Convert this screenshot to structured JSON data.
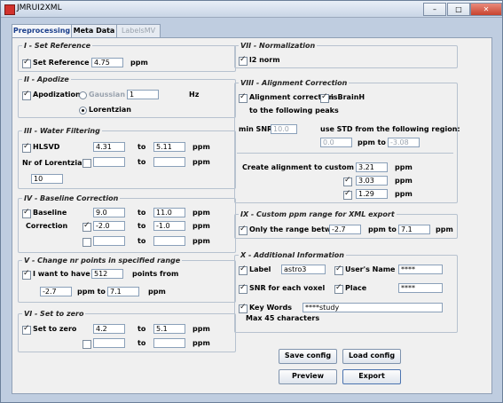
{
  "window": {
    "title": "JMRUI2XML",
    "btn_min": "–",
    "btn_max": "□",
    "btn_close": "✕"
  },
  "tabs": [
    {
      "label": "Preprocessing"
    },
    {
      "label": "Meta Data"
    },
    {
      "label": "LabelsMV"
    }
  ],
  "s1": {
    "legend": "I - Set Reference",
    "check": "Set Reference",
    "value": "4.75",
    "unit": "ppm"
  },
  "s2": {
    "legend": "II - Apodize",
    "check": "Apodization",
    "gaussian": "Gaussian",
    "value": "1",
    "unit": "Hz",
    "lorentzian": "Lorentzian"
  },
  "s3": {
    "legend": "III - Water Filtering",
    "check": "HLSVD",
    "from1": "4.31",
    "to": "to",
    "to1": "5.11",
    "unit": "ppm",
    "nr_label": "Nr of Lorentzians",
    "from2": "",
    "to2": "",
    "nr_value": "10"
  },
  "s4": {
    "legend": "IV - Baseline Correction",
    "check1": "Baseline",
    "check1b": "Correction",
    "from1": "9.0",
    "to1": "11.0",
    "from2": "-2.0",
    "to2": "-1.0",
    "from3": "",
    "to3": "",
    "to": "to",
    "unit": "ppm"
  },
  "s5": {
    "legend": "V - Change nr points in specified range",
    "check": "I want to have",
    "points": "512",
    "points_from": "points from",
    "from": "-2.7",
    "ppm_to": "ppm to",
    "to": "7.1",
    "unit": "ppm"
  },
  "s6": {
    "legend": "VI - Set to zero",
    "check": "Set to zero",
    "from1": "4.2",
    "to1": "5.1",
    "from2": "",
    "to2": "",
    "to": "to",
    "unit": "ppm"
  },
  "s7": {
    "legend": "VII - Normalization",
    "check": "l2 norm"
  },
  "s8": {
    "legend": "VIII - Alignment Correction",
    "check": "Alignment correction",
    "brain": "isBrainH",
    "peaks_label": "to the following peaks",
    "min_snr_label": "min SNR:",
    "min_snr": "10.0",
    "std_label": "use STD from the following region:",
    "std_from": "0.0",
    "ppm_to": "ppm to",
    "std_to": "-3.08",
    "custom_label": "Create alignment to custom peaks",
    "peak1": "3.21",
    "peak2": "3.03",
    "peak3": "1.29",
    "unit": "ppm"
  },
  "s9": {
    "legend": "IX - Custom ppm range for XML export",
    "check": "Only the range between",
    "from": "-2.7",
    "ppm_to": "ppm to",
    "to": "7.1",
    "unit": "ppm"
  },
  "s10": {
    "legend": "X - Additional Information",
    "label_check": "Label",
    "label_value": "astro3",
    "user_check": "User's Name",
    "user_value": "****",
    "snr_check": "SNR for each voxel",
    "place_check": "Place",
    "place_value": "****",
    "kw_check": "Key Words",
    "kw_value": "****study",
    "max_note": "Max 45 characters"
  },
  "buttons": {
    "save": "Save config",
    "load": "Load config",
    "preview": "Preview",
    "export": "Export"
  }
}
